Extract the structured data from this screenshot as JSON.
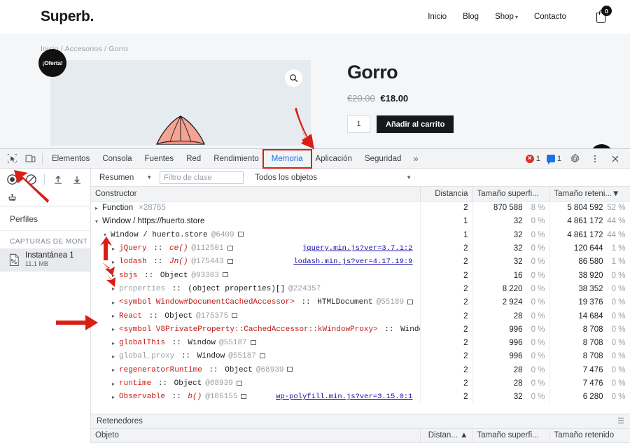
{
  "site": {
    "brand": "Superb.",
    "nav": [
      {
        "label": "Inicio"
      },
      {
        "label": "Blog"
      },
      {
        "label": "Shop",
        "has_caret": true
      },
      {
        "label": "Contacto"
      }
    ],
    "cart_count": "0",
    "breadcrumb": "Inicio / Accesorios / Gorro",
    "sale_badge": "¡Oferta!",
    "product": {
      "title": "Gorro",
      "price_old": "€20.00",
      "price_new": "€18.00",
      "quantity": "1",
      "add_to_cart": "Añadir al carrito"
    },
    "zoom_icon": "search-icon",
    "scroll_top_icon": "chevron-up-icon"
  },
  "devtools": {
    "tabs": [
      {
        "label": "Elementos",
        "active": false
      },
      {
        "label": "Consola",
        "active": false
      },
      {
        "label": "Fuentes",
        "active": false
      },
      {
        "label": "Red",
        "active": false
      },
      {
        "label": "Rendimiento",
        "active": false
      },
      {
        "label": "Memoria",
        "active": true,
        "highlighted": true
      },
      {
        "label": "Aplicación",
        "active": false
      },
      {
        "label": "Seguridad",
        "active": false
      }
    ],
    "more_tabs": "»",
    "errors_count": "1",
    "messages_count": "1",
    "left_icons": [
      "inspect-icon",
      "device-toolbar-icon"
    ],
    "right_icons": [
      "settings-gear-icon",
      "more-options-icon",
      "close-icon"
    ],
    "profiler": {
      "toolbar_icons": [
        "record-icon",
        "clear-icon",
        "load-profile-icon",
        "save-profile-icon",
        "collect-garbage-icon"
      ],
      "profiles_label": "Perfiles",
      "group_label": "CAPTURAS DE MONT",
      "snapshot_name": "Instantánea 1",
      "snapshot_size": "11.1 MB"
    },
    "filter_bar": {
      "view_select": "Resumen",
      "class_filter_placeholder": "Filtro de clase",
      "class_filter_value": "",
      "object_select": "Todos los objetos"
    },
    "table": {
      "columns": [
        "Constructor",
        "Distancia",
        "Tamaño superfi...",
        "Tamaño reteni..."
      ],
      "sorted_column": "Tamaño reteni...",
      "sort_direction": "desc",
      "rows": [
        {
          "indent": 0,
          "tri": "closed",
          "name": "Function",
          "name_style": "plain",
          "count": "×28765",
          "distance": "2",
          "shallow": "870 588",
          "shallow_pct": "8 %",
          "retained": "5 804 592",
          "retained_pct": "52 %"
        },
        {
          "indent": 0,
          "tri": "open",
          "name": "Window / https://huerto.store",
          "name_style": "plain",
          "distance": "1",
          "shallow": "32",
          "shallow_pct": "0 %",
          "retained": "4 861 172",
          "retained_pct": "44 %"
        },
        {
          "indent": 1,
          "tri": "open",
          "name": "Window / huerto.store",
          "name_style": "mono-plain",
          "id": "@6409",
          "box": true,
          "distance": "1",
          "shallow": "32",
          "shallow_pct": "0 %",
          "retained": "4 861 172",
          "retained_pct": "44 %"
        },
        {
          "indent": 2,
          "tri": "closed",
          "name": "jQuery",
          "type": "ce()",
          "type_italic": true,
          "id": "@112501",
          "box": true,
          "link": "jquery.min.js?ver=3.7.1:2",
          "distance": "2",
          "shallow": "32",
          "shallow_pct": "0 %",
          "retained": "120 644",
          "retained_pct": "1 %"
        },
        {
          "indent": 2,
          "tri": "closed",
          "name": "lodash",
          "type": "Jn()",
          "type_italic": true,
          "id": "@175443",
          "box": true,
          "link": "lodash.min.js?ver=4.17.19:9",
          "distance": "2",
          "shallow": "32",
          "shallow_pct": "0 %",
          "retained": "86 580",
          "retained_pct": "1 %"
        },
        {
          "indent": 2,
          "tri": "closed",
          "name": "sbjs",
          "type": "Object",
          "id": "@93303",
          "box": true,
          "distance": "2",
          "shallow": "16",
          "shallow_pct": "0 %",
          "retained": "38 920",
          "retained_pct": "0 %"
        },
        {
          "indent": 2,
          "tri": "closed",
          "name": "properties",
          "name_style": "dim",
          "type": "(object properties)[]",
          "id": "@224357",
          "distance": "2",
          "shallow": "8 220",
          "shallow_pct": "0 %",
          "retained": "38 352",
          "retained_pct": "0 %"
        },
        {
          "indent": 2,
          "tri": "closed",
          "name": "<symbol Window#DocumentCachedAccessor>",
          "type": "HTMLDocument",
          "id": "@55189",
          "box": true,
          "distance": "2",
          "shallow": "2 924",
          "shallow_pct": "0 %",
          "retained": "19 376",
          "retained_pct": "0 %"
        },
        {
          "indent": 2,
          "tri": "closed",
          "name": "React",
          "type": "Object",
          "id": "@175375",
          "box": true,
          "distance": "2",
          "shallow": "28",
          "shallow_pct": "0 %",
          "retained": "14 684",
          "retained_pct": "0 %"
        },
        {
          "indent": 2,
          "tri": "closed",
          "name": "<symbol V8PrivateProperty::CachedAccessor::kWindowProxy>",
          "type": "Windo",
          "distance": "2",
          "shallow": "996",
          "shallow_pct": "0 %",
          "retained": "8 708",
          "retained_pct": "0 %"
        },
        {
          "indent": 2,
          "tri": "closed",
          "name": "globalThis",
          "type": "Window",
          "id": "@55187",
          "box": true,
          "distance": "2",
          "shallow": "996",
          "shallow_pct": "0 %",
          "retained": "8 708",
          "retained_pct": "0 %"
        },
        {
          "indent": 2,
          "tri": "closed",
          "name": "global_proxy",
          "name_style": "dim",
          "type": "Window",
          "id": "@55187",
          "box": true,
          "distance": "2",
          "shallow": "996",
          "shallow_pct": "0 %",
          "retained": "8 708",
          "retained_pct": "0 %"
        },
        {
          "indent": 2,
          "tri": "closed",
          "name": "regeneratorRuntime",
          "type": "Object",
          "id": "@68939",
          "box": true,
          "distance": "2",
          "shallow": "28",
          "shallow_pct": "0 %",
          "retained": "7 476",
          "retained_pct": "0 %"
        },
        {
          "indent": 2,
          "tri": "closed",
          "name": "runtime",
          "type": "Object",
          "id": "@68939",
          "box": true,
          "distance": "2",
          "shallow": "28",
          "shallow_pct": "0 %",
          "retained": "7 476",
          "retained_pct": "0 %"
        },
        {
          "indent": 2,
          "tri": "closed",
          "name": "Observable",
          "type": "b()",
          "type_italic": true,
          "id": "@186155",
          "box": true,
          "link": "wp-polyfill.min.js?ver=3.15.0:1",
          "distance": "2",
          "shallow": "32",
          "shallow_pct": "0 %",
          "retained": "6 280",
          "retained_pct": "0 %"
        }
      ]
    },
    "retainers": {
      "title": "Retenedores",
      "columns": [
        "Objeto",
        "Distan...",
        "Tamaño superfi...",
        "Tamaño retenido"
      ],
      "sorted_column": "Distan...",
      "sort_direction": "asc"
    }
  },
  "annotations": {
    "arrow_color": "#d91f14",
    "highlight_color": "#d91f14",
    "arrows": [
      {
        "name": "arrow-to-memoria-tab"
      },
      {
        "name": "arrow-to-record-button"
      },
      {
        "name": "arrow-to-tree-rows"
      },
      {
        "name": "arrow-to-constructor-column"
      }
    ]
  }
}
